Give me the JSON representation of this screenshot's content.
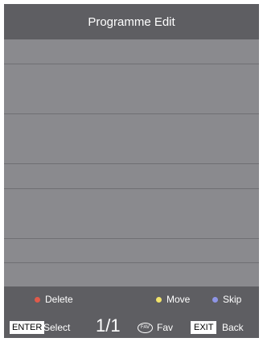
{
  "header": {
    "title": "Programme Edit"
  },
  "channel_list": {
    "rows": []
  },
  "color_keys": {
    "delete": {
      "label": "Delete",
      "color": "#e05a4a"
    },
    "move": {
      "label": "Move",
      "color": "#f1e36a"
    },
    "skip": {
      "label": "Skip",
      "color": "#8e95e6"
    }
  },
  "nav": {
    "enter_key": "ENTER",
    "select_label": "Select",
    "page_indicator": "1/1",
    "fav_key": "FAV",
    "fav_label": "Fav",
    "exit_key": "EXIT",
    "back_label": "Back"
  }
}
